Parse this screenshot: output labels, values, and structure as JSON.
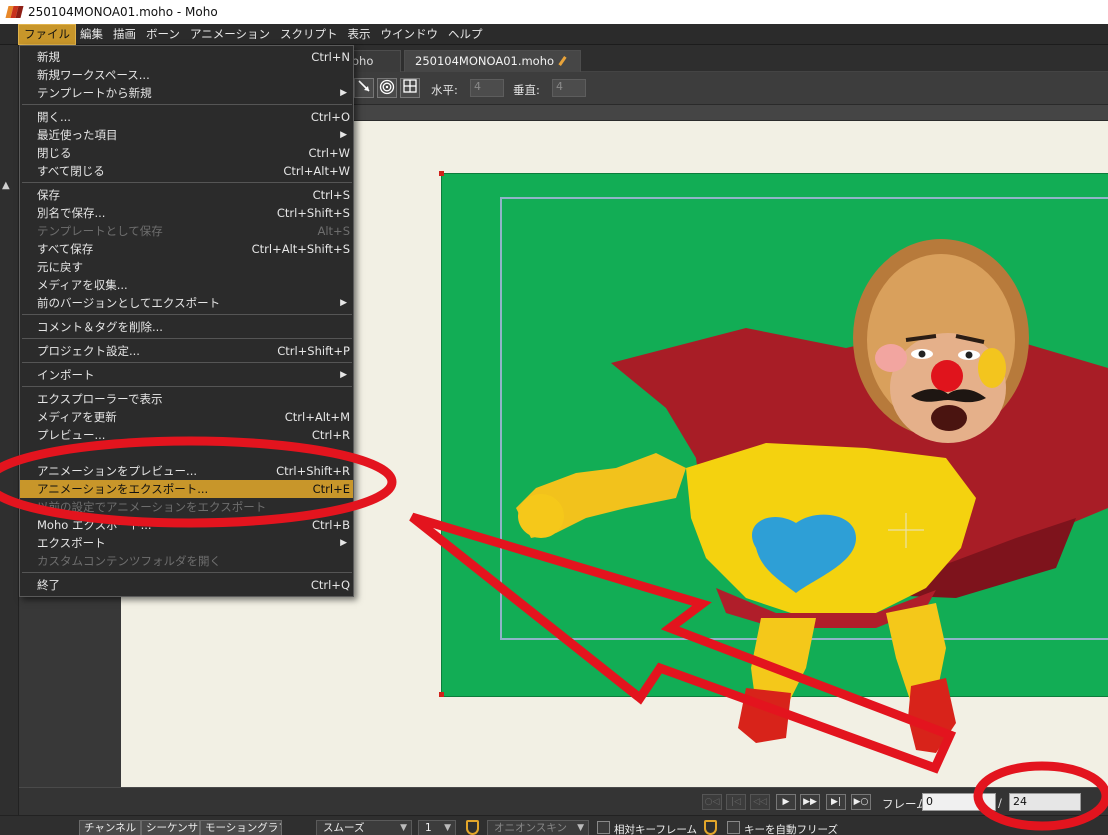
{
  "window": {
    "title": "250104MONOA01.moho - Moho"
  },
  "menubar": {
    "items": [
      {
        "label": "ファイル",
        "active": true
      },
      {
        "label": "編集"
      },
      {
        "label": "描画"
      },
      {
        "label": "ボーン"
      },
      {
        "label": "アニメーション"
      },
      {
        "label": "スクリプト"
      },
      {
        "label": "表示"
      },
      {
        "label": "ウインドウ"
      },
      {
        "label": "ヘルプ"
      }
    ]
  },
  "file_menu": {
    "items": [
      {
        "label": "新規",
        "shortcut": "Ctrl+N"
      },
      {
        "label": "新規ワークスペース..."
      },
      {
        "label": "テンプレートから新規",
        "submenu": true
      },
      {
        "label": "開く...",
        "shortcut": "Ctrl+O"
      },
      {
        "label": "最近使った項目",
        "submenu": true
      },
      {
        "label": "閉じる",
        "shortcut": "Ctrl+W"
      },
      {
        "label": "すべて閉じる",
        "shortcut": "Ctrl+Alt+W"
      },
      {
        "label": "保存",
        "shortcut": "Ctrl+S"
      },
      {
        "label": "別名で保存...",
        "shortcut": "Ctrl+Shift+S"
      },
      {
        "label": "テンプレートとして保存",
        "shortcut": "Alt+S",
        "disabled": true
      },
      {
        "label": "すべて保存",
        "shortcut": "Ctrl+Alt+Shift+S"
      },
      {
        "label": "元に戻す"
      },
      {
        "label": "メディアを収集..."
      },
      {
        "label": "前のバージョンとしてエクスポート",
        "submenu": true
      },
      {
        "label": "コメント＆タグを削除..."
      },
      {
        "label": "プロジェクト設定...",
        "shortcut": "Ctrl+Shift+P"
      },
      {
        "label": "インポート",
        "submenu": true
      },
      {
        "label": "エクスプローラーで表示"
      },
      {
        "label": "メディアを更新",
        "shortcut": "Ctrl+Alt+M"
      },
      {
        "label": "プレビュー...",
        "shortcut": "Ctrl+R"
      },
      {
        "label": "アニメーションをプレビュー...",
        "shortcut": "Ctrl+Shift+R"
      },
      {
        "label": "アニメーションをエクスポート...",
        "shortcut": "Ctrl+E",
        "highlight": true
      },
      {
        "label": "以前の設定でアニメーションをエクスポート",
        "disabled": true
      },
      {
        "label": "Moho エクスポート...",
        "shortcut": "Ctrl+B"
      },
      {
        "label": "エクスポート",
        "submenu": true
      },
      {
        "label": "カスタムコンテンツフォルダを開く",
        "disabled": true
      },
      {
        "label": "終了",
        "shortcut": "Ctrl+Q"
      }
    ]
  },
  "doc_tabs": [
    {
      "label": "oho"
    },
    {
      "label": "250104MONOA01.moho",
      "modified": true
    }
  ],
  "tool_options": {
    "horizontal_label": "水平:",
    "horizontal_value": "4",
    "vertical_label": "垂直:",
    "vertical_value": "4"
  },
  "timeline": {
    "frame_label": "フレーム",
    "current_frame": "0",
    "separator": "/",
    "total_frames": "24"
  },
  "bottom_bar": {
    "tabs": [
      "チャンネル",
      "シーケンサ",
      "モーショングラフ"
    ],
    "interpolation": "スムーズ",
    "step": "1",
    "onion_skin": "オニオンスキン",
    "relative_keyframe": "相対キーフレーム",
    "auto_freeze_keys": "キーを自動フリーズ"
  },
  "colors": {
    "menu_highlight": "#c8962a",
    "stage_green": "#12ad55",
    "canvas_bg": "#f2f0e4",
    "annotation_red": "#e3141e"
  },
  "icons": {
    "toolbar": [
      "arrow-icon",
      "spiral-icon",
      "grid-icon"
    ],
    "playback": [
      "rewind-start-icon",
      "step-back-icon",
      "play-back-icon",
      "play-icon",
      "play-fast-icon",
      "step-forward-icon",
      "loop-icon"
    ]
  }
}
